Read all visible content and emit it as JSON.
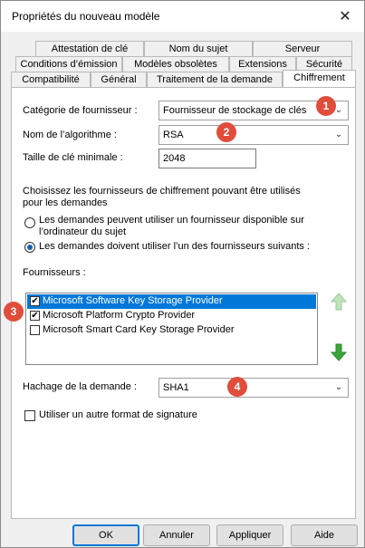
{
  "window": {
    "title": "Propriétés du nouveau modèle",
    "close_glyph": "✕"
  },
  "tabs": {
    "row1": [
      "Attestation de clé",
      "Nom du sujet",
      "Serveur"
    ],
    "row2": [
      "Conditions d’émission",
      "Modèles obsolètes",
      "Extensions",
      "Sécurité"
    ],
    "row3": [
      "Compatibilité",
      "Général",
      "Traitement de la demande",
      "Chiffrement"
    ],
    "active": "Chiffrement"
  },
  "form": {
    "provider_category_label": "Catégorie de fournisseur :",
    "provider_category_value": "Fournisseur de stockage de clés",
    "algorithm_label": "Nom de l’algorithme :",
    "algorithm_value": "RSA",
    "min_key_size_label": "Taille de clé minimale :",
    "min_key_size_value": "2048",
    "choose_text_line1": "Choisissez les fournisseurs de chiffrement pouvant être utilisés",
    "choose_text_line2": "pour les demandes",
    "radio1_line1": "Les demandes peuvent utiliser un fournisseur disponible sur",
    "radio1_line2": "l’ordinateur du sujet",
    "radio2": "Les demandes doivent utiliser l’un des fournisseurs suivants :",
    "providers_label": "Fournisseurs :",
    "providers": [
      {
        "name": "Microsoft Software Key Storage Provider",
        "checked": true,
        "selected": true
      },
      {
        "name": "Microsoft Platform Crypto Provider",
        "checked": true,
        "selected": false
      },
      {
        "name": "Microsoft Smart Card Key Storage Provider",
        "checked": false,
        "selected": false
      }
    ],
    "hash_label": "Hachage de la demande :",
    "hash_value": "SHA1",
    "alt_signature_label": "Utiliser un autre format de signature"
  },
  "badges": [
    "1",
    "2",
    "3",
    "4"
  ],
  "buttons": {
    "ok": "OK",
    "cancel": "Annuler",
    "apply": "Appliquer",
    "help": "Aide"
  },
  "colors": {
    "badge": "#e04d3b",
    "selection": "#0078d7",
    "arrow_green": "#3aa53a"
  }
}
